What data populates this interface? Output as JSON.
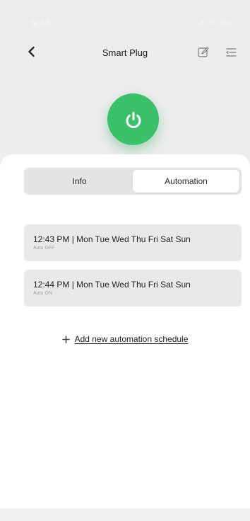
{
  "status_bar": {
    "time": "9:46"
  },
  "header": {
    "title": "Smart Plug"
  },
  "icons": {
    "back": "chevron-left-icon",
    "edit": "edit-icon",
    "menu": "menu-icon",
    "power": "power-icon",
    "add": "plus-icon"
  },
  "colors": {
    "power": "#3cc16b",
    "background": "#ededee",
    "card": "#e9e9ea"
  },
  "tabs": [
    {
      "label": "Info",
      "active": false
    },
    {
      "label": "Automation",
      "active": true
    }
  ],
  "schedules": [
    {
      "time": "12:43 PM",
      "days": "Mon Tue Wed Thu Fri Sat Sun",
      "action": "Auto OFF"
    },
    {
      "time": "12:44 PM",
      "days": "Mon Tue Wed Thu Fri Sat Sun",
      "action": "Auto ON"
    }
  ],
  "add_schedule": {
    "label": "Add new automation schedule"
  }
}
